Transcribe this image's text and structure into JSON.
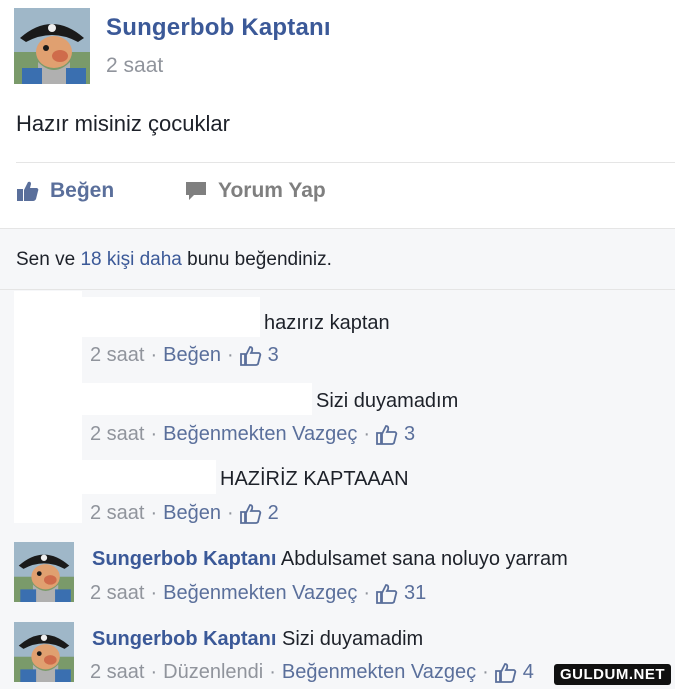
{
  "post": {
    "author": "Sungerbob Kaptanı",
    "time": "2 saat",
    "text": "Hazır misiniz çocuklar"
  },
  "actions": {
    "like": "Beğen",
    "comment": "Yorum Yap"
  },
  "likes_summary": {
    "prefix": "Sen ve",
    "link": "18 kişi daha",
    "suffix": "bunu beğendiniz."
  },
  "comments": [
    {
      "author": "",
      "text": "hazırız kaptan",
      "time": "2 saat",
      "action": "Beğen",
      "likes": "3"
    },
    {
      "author": "",
      "text": "Sizi duyamadım",
      "time": "2 saat",
      "action": "Beğenmekten Vazgeç",
      "likes": "3"
    },
    {
      "author": "",
      "text": "HAZİRİZ KAPTAAAN",
      "time": "2 saat",
      "action": "Beğen",
      "likes": "2"
    },
    {
      "author": "Sungerbob Kaptanı",
      "text": "Abdulsamet sana noluyo yarram",
      "time": "2 saat",
      "action": "Beğenmekten Vazgeç",
      "likes": "31"
    },
    {
      "author": "Sungerbob Kaptanı",
      "text": "Sizi duyamadim",
      "time": "2 saat",
      "edited": "Düzenlendi",
      "action": "Beğenmekten Vazgeç",
      "likes": "4"
    }
  ],
  "separator": "·",
  "watermark": "GULDUM.NET",
  "colors": {
    "link": "#3b5998",
    "meta": "#90949c",
    "background": "#f6f7f9"
  }
}
